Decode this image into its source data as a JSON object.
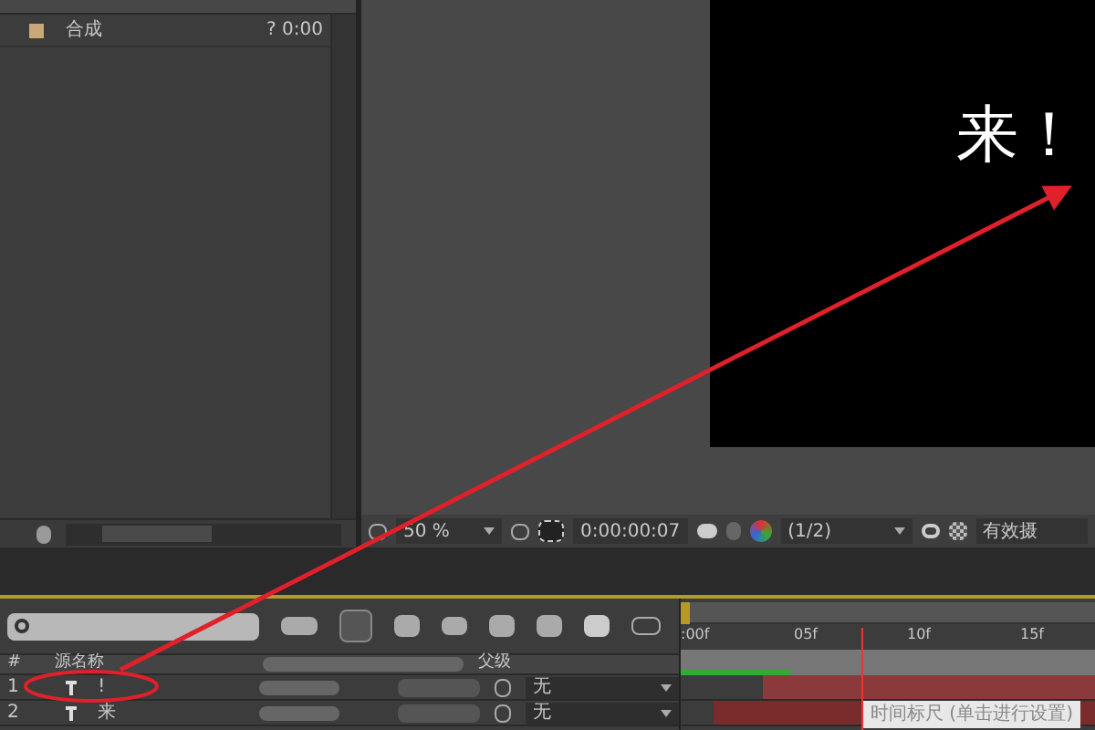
{
  "project": {
    "items": [
      {
        "name": "合成",
        "duration": "? 0:00",
        "color": "#c8a878"
      }
    ]
  },
  "viewer": {
    "canvas_text": "来！",
    "toolbar": {
      "zoom": "50 %",
      "timecode": "0:00:00:07",
      "resolution": "(1/2)",
      "label": "有效摄"
    }
  },
  "timeline": {
    "ruler": [
      ":00f",
      "05f",
      "10f",
      "15f"
    ],
    "columns": {
      "number": "#",
      "name": "源名称",
      "parent": "父级"
    },
    "layers": [
      {
        "index": "1",
        "name": "!",
        "parent": "无"
      },
      {
        "index": "2",
        "name": "来",
        "parent": "无"
      }
    ],
    "tooltip": "时间标尺 (单击进行设置)"
  }
}
